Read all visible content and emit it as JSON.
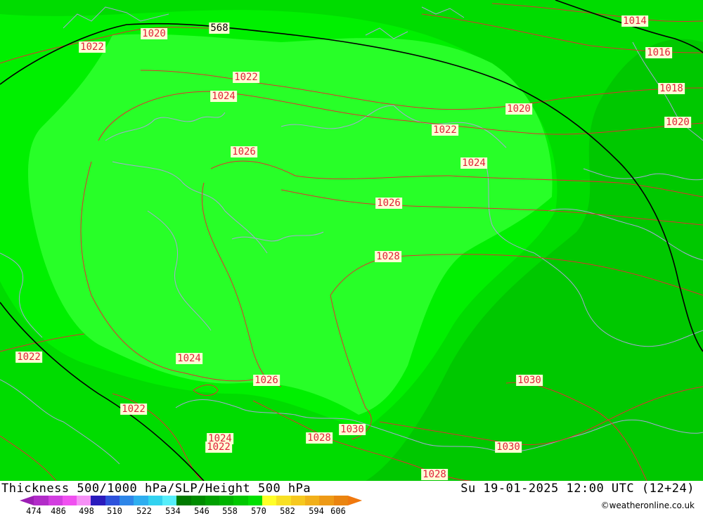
{
  "title": "Thickness 500/1000 hPa/SLP/Height 500 hPa",
  "valid_time": "Su 19-01-2025 12:00 UTC (12+24)",
  "credit": "©weatheronline.co.uk",
  "legend": {
    "ticks": [
      "474",
      "486",
      "498",
      "510",
      "522",
      "534",
      "546",
      "558",
      "570",
      "582",
      "594",
      "606"
    ],
    "colors": [
      "#9c1fb4",
      "#b22cc8",
      "#d23ee0",
      "#f050f0",
      "#f690f6",
      "#2a1bbd",
      "#2d52dc",
      "#2e86e8",
      "#2eaef0",
      "#32d2f0",
      "#56eefa",
      "#007a00",
      "#008c00",
      "#00a000",
      "#00b400",
      "#00c800",
      "#00e000",
      "#ffff28",
      "#f8e024",
      "#f6c81e",
      "#f2b01a",
      "#ee9a16",
      "#ea8410",
      "#f0780e"
    ]
  },
  "colors": {
    "shade_558": "#00c800",
    "shade_552": "#00dc00",
    "shade_546": "#00f000",
    "shade_540": "#28ff28",
    "isobar": "#e03030",
    "height_contour": "#000000",
    "coastline": "#a6a6d8"
  },
  "height_labels": [
    {
      "id": "h568",
      "text": "568"
    }
  ],
  "pressure_labels": [
    {
      "id": "p1",
      "text": "1022"
    },
    {
      "id": "p2",
      "text": "1020"
    },
    {
      "id": "p3",
      "text": "1022"
    },
    {
      "id": "p4",
      "text": "1024"
    },
    {
      "id": "p5",
      "text": "1026"
    },
    {
      "id": "p6",
      "text": "1014"
    },
    {
      "id": "p7",
      "text": "1016"
    },
    {
      "id": "p8",
      "text": "1018"
    },
    {
      "id": "p9",
      "text": "1020"
    },
    {
      "id": "p10",
      "text": "1020"
    },
    {
      "id": "p11",
      "text": "1022"
    },
    {
      "id": "p12",
      "text": "1024"
    },
    {
      "id": "p13",
      "text": "1026"
    },
    {
      "id": "p14",
      "text": "1028"
    },
    {
      "id": "p15",
      "text": "1022"
    },
    {
      "id": "p16",
      "text": "1024"
    },
    {
      "id": "p17",
      "text": "1026"
    },
    {
      "id": "p18",
      "text": "1022"
    },
    {
      "id": "p19",
      "text": "1024"
    },
    {
      "id": "p20",
      "text": "1022"
    },
    {
      "id": "p21",
      "text": "1028"
    },
    {
      "id": "p22",
      "text": "1030"
    },
    {
      "id": "p23",
      "text": "1030"
    },
    {
      "id": "p24",
      "text": "1030"
    },
    {
      "id": "p25",
      "text": "1028"
    }
  ]
}
